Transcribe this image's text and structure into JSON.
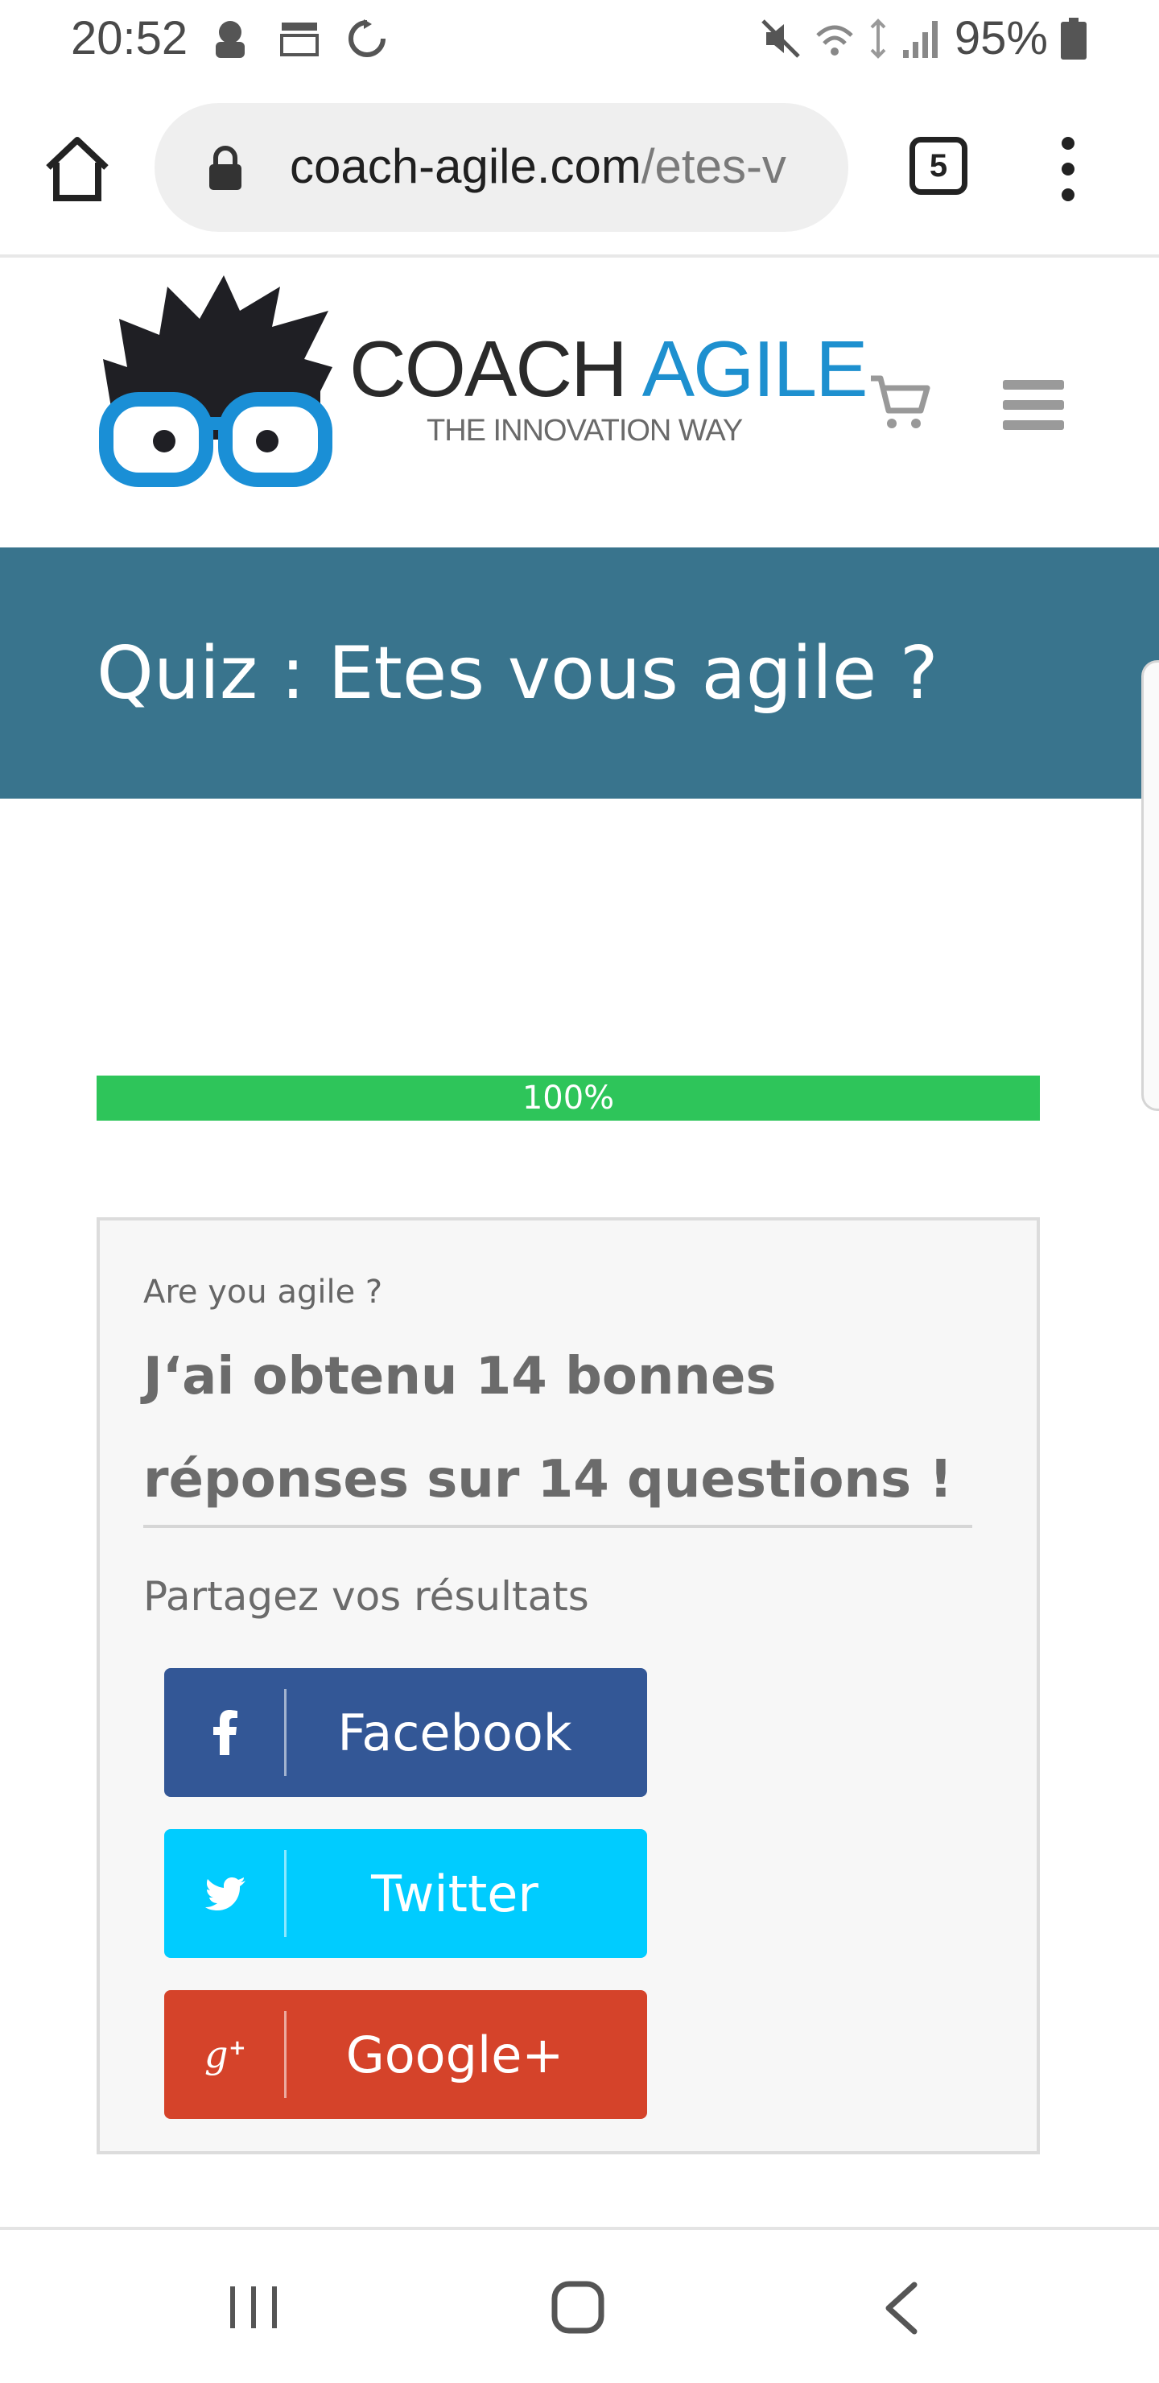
{
  "status_bar": {
    "time": "20:52",
    "battery": "95%",
    "network": "4G"
  },
  "browser": {
    "url_domain": "coach-agile.com",
    "url_path": "/etes-v",
    "tab_count": "5"
  },
  "site": {
    "logo_word1": "COACH",
    "logo_word2": "AGILE",
    "tagline": "THE INNOVATION WAY"
  },
  "page": {
    "title": "Quiz : Etes vous agile ?"
  },
  "progress": {
    "value": 1.0,
    "label": "100%"
  },
  "result": {
    "quiz_name": "Are you agile ?",
    "score_text": "J‘ai obtenu 14 bonnes réponses sur 14 questions !",
    "share_label": "Partagez vos résultats"
  },
  "share_buttons": {
    "facebook": "Facebook",
    "twitter": "Twitter",
    "google": "Google+"
  },
  "colors": {
    "title_band": "#39748d",
    "progress": "#2ec55a",
    "facebook": "#335796",
    "twitter": "#00ccff",
    "google": "#d5432a"
  }
}
